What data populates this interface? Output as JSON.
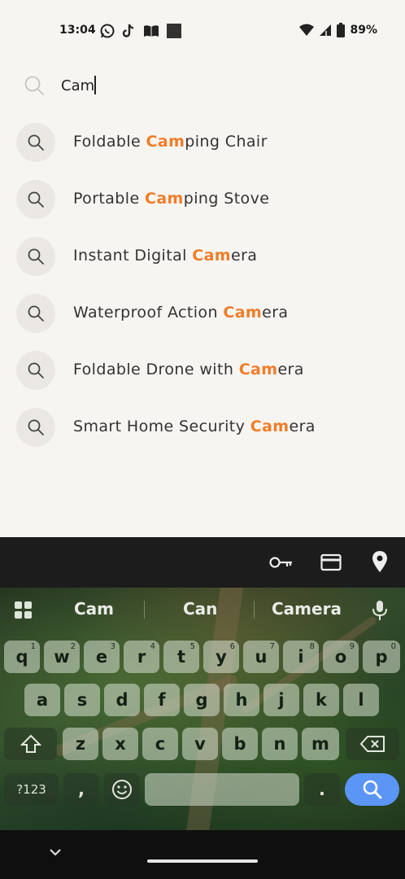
{
  "status_bar": {
    "time": "13:04",
    "battery": "89%",
    "left_icons": [
      "whatsapp-icon",
      "tiktok-icon",
      "book-icon",
      "square-icon"
    ],
    "right_icons": [
      "wifi-icon",
      "signal-icon",
      "battery-icon"
    ]
  },
  "search": {
    "value": "Cam",
    "placeholder": ""
  },
  "suggestions": [
    {
      "before": "Foldable ",
      "match": "Cam",
      "after": "ping Chair"
    },
    {
      "before": "Portable ",
      "match": "Cam",
      "after": "ping Stove"
    },
    {
      "before": "Instant Digital ",
      "match": "Cam",
      "after": "era"
    },
    {
      "before": "Waterproof Action ",
      "match": "Cam",
      "after": "era"
    },
    {
      "before": "Foldable Drone with ",
      "match": "Cam",
      "after": "era"
    },
    {
      "before": "Smart Home Security ",
      "match": "Cam",
      "after": "era"
    }
  ],
  "colors": {
    "highlight": "#f07d2a",
    "background": "#f7f5f2",
    "search_key": "#5b95f5"
  },
  "keyboard": {
    "toolbar_icons": [
      "key-icon",
      "card-icon",
      "location-pin-icon"
    ],
    "word_suggestions": [
      "Cam",
      "Can",
      "Camera"
    ],
    "row1": [
      {
        "k": "q",
        "h": "1"
      },
      {
        "k": "w",
        "h": "2"
      },
      {
        "k": "e",
        "h": "3"
      },
      {
        "k": "r",
        "h": "4"
      },
      {
        "k": "t",
        "h": "5"
      },
      {
        "k": "y",
        "h": "6"
      },
      {
        "k": "u",
        "h": "7"
      },
      {
        "k": "i",
        "h": "8"
      },
      {
        "k": "o",
        "h": "9"
      },
      {
        "k": "p",
        "h": "0"
      }
    ],
    "row2": [
      "a",
      "s",
      "d",
      "f",
      "g",
      "h",
      "j",
      "k",
      "l"
    ],
    "row3": [
      "z",
      "x",
      "c",
      "v",
      "b",
      "n",
      "m"
    ],
    "symbols_label": "?123",
    "comma": ",",
    "period": "."
  }
}
